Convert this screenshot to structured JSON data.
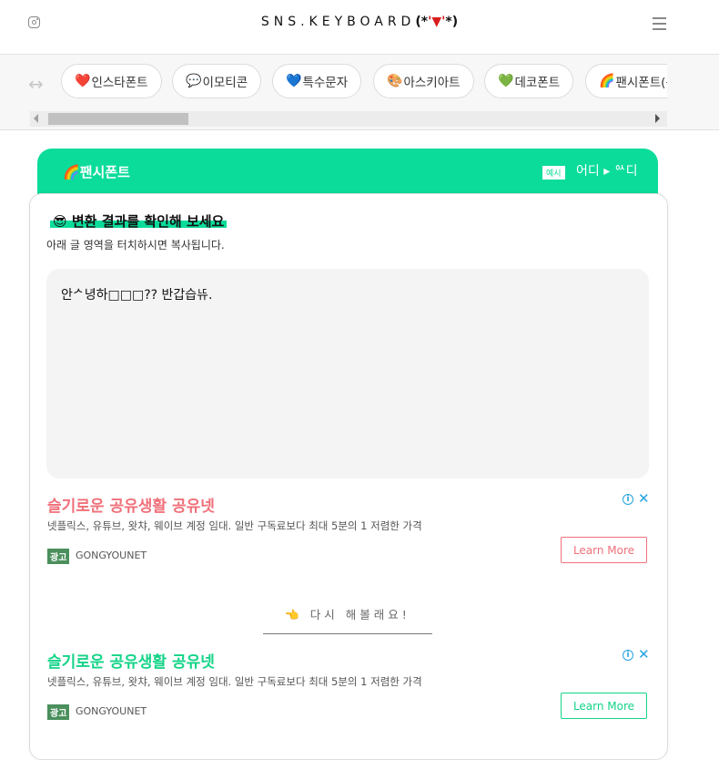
{
  "header": {
    "logo_text": "SNS.KEYBOARD",
    "logo_face_left": "(*",
    "logo_face_tongue": "'▼'",
    "logo_face_right": "*)",
    "instagram_icon": "instagram-icon",
    "menu_icon": "hamburger-menu-icon"
  },
  "tabs": {
    "scroll_hint_icon": "↔",
    "items": [
      {
        "icon": "❤️",
        "label": "인스타폰트"
      },
      {
        "icon": "💬",
        "label": "이모티콘"
      },
      {
        "icon": "💙",
        "label": "특수문자"
      },
      {
        "icon": "🎨",
        "label": "아스키아트"
      },
      {
        "icon": "💚",
        "label": "데코폰트"
      },
      {
        "icon": "🌈",
        "label": "팬시폰트(특"
      }
    ]
  },
  "panel": {
    "title_icon": "🌈",
    "title": "팬시폰트",
    "example_badge": "예시",
    "example_text": "어디 ▸ ᅅ디"
  },
  "result": {
    "title_icon": "😎",
    "title": "변환 결과를 확인해 보세요",
    "subtitle": "아래 글 영역을 터치하시면 복사됩니다.",
    "output_text": "안ᄼ녕하□□□?? 반갑습ᄕᅲ."
  },
  "ads": [
    {
      "title": "슬기로운 공유생활 공유넷",
      "title_color": "#f0707a",
      "description": "넷플릭스, 유튜브, 왓챠, 웨이브 계정 임대. 일반 구독료보다 최대 5분의 1 저렴한 가격",
      "badge": "광고",
      "brand": "GONGYOUNET",
      "cta": "Learn More",
      "info_icon": "i",
      "close_icon": "✕"
    },
    {
      "title": "슬기로운 공유생활 공유넷",
      "title_color": "#13d487",
      "description": "넷플릭스, 유튜브, 왓챠, 웨이브 계정 임대. 일반 구독료보다 최대 5분의 1 저렴한 가격",
      "badge": "광고",
      "brand": "GONGYOUNET",
      "cta": "Learn More",
      "info_icon": "i",
      "close_icon": "✕"
    }
  ],
  "retry": {
    "icon": "👈",
    "label": "다시 해볼래요!"
  },
  "colors": {
    "accent": "#0bdc9a",
    "ad1_accent": "#f0707a",
    "ad2_accent": "#13d487",
    "ad_close": "#23a3e0"
  }
}
